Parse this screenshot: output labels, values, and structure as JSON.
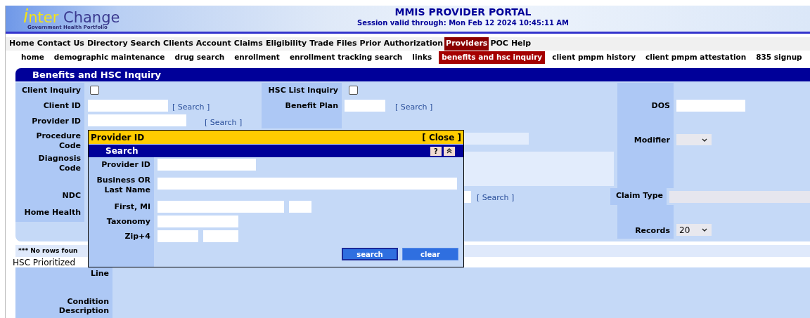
{
  "header": {
    "logo": {
      "mark": "i",
      "first": "nter",
      "second": "Change",
      "tagline": "Government Health Portfolio"
    },
    "title": "MMIS PROVIDER PORTAL",
    "session": "Session valid through: Mon Feb 12 2024 10:45:11 AM"
  },
  "main_menu": [
    {
      "label": "Home",
      "selected": false
    },
    {
      "label": "Contact Us",
      "selected": false
    },
    {
      "label": "Directory Search",
      "selected": false
    },
    {
      "label": "Clients",
      "selected": false
    },
    {
      "label": "Account",
      "selected": false
    },
    {
      "label": "Claims",
      "selected": false
    },
    {
      "label": "Eligibility",
      "selected": false
    },
    {
      "label": "Trade Files",
      "selected": false
    },
    {
      "label": "Prior Authorization",
      "selected": false
    },
    {
      "label": "Providers",
      "selected": true
    },
    {
      "label": "POC",
      "selected": false
    },
    {
      "label": "Help",
      "selected": false
    }
  ],
  "sub_menu": [
    {
      "label": "home",
      "selected": false
    },
    {
      "label": "demographic maintenance",
      "selected": false
    },
    {
      "label": "drug search",
      "selected": false
    },
    {
      "label": "enrollment",
      "selected": false
    },
    {
      "label": "enrollment tracking search",
      "selected": false
    },
    {
      "label": "links",
      "selected": false
    },
    {
      "label": "benefits and hsc inquiry",
      "selected": true
    },
    {
      "label": "client pmpm history",
      "selected": false
    },
    {
      "label": "client pmpm attestation",
      "selected": false
    },
    {
      "label": "835 signup",
      "selected": false
    }
  ],
  "panel": {
    "title": "Benefits and HSC Inquiry",
    "client_inquiry": {
      "label": "Client Inquiry",
      "checked": false
    },
    "hsc_list_inquiry": {
      "label": "HSC List Inquiry",
      "checked": false
    },
    "client_id": {
      "label": "Client ID",
      "link": "[ Search ]"
    },
    "benefit_plan": {
      "label": "Benefit Plan",
      "link": "[ Search ]"
    },
    "dos": {
      "label": "DOS"
    },
    "provider_id": {
      "label": "Provider ID",
      "link": "[ Search ]"
    },
    "procedure_code": {
      "label": "Procedure Code",
      "disabled": true
    },
    "modifier": {
      "label": "Modifier"
    },
    "diagnosis_code": {
      "label": "Diagnosis Code"
    },
    "ndc": {
      "label": "NDC",
      "link": "[ Search ]"
    },
    "claim_type": {
      "label": "Claim Type",
      "disabled": true
    },
    "home_health": {
      "label": "Home Health"
    },
    "records": {
      "label": "Records",
      "value": "20"
    }
  },
  "results": {
    "message": "*** No rows foun",
    "hsc_title": "HSC Prioritized",
    "labels": [
      "Line",
      "Condition Description"
    ]
  },
  "popup": {
    "title": "Provider ID",
    "close": "[ Close ]",
    "subtitle": "Search",
    "help": "?",
    "fields": [
      {
        "label": "Provider ID",
        "kind": "single"
      },
      {
        "label": "Business OR Last Name",
        "kind": "wide"
      },
      {
        "label": "First, MI",
        "kind": "name"
      },
      {
        "label": "Taxonomy",
        "kind": "single"
      },
      {
        "label": "Zip+4",
        "kind": "zip"
      }
    ],
    "buttons": [
      "search",
      "clear"
    ]
  }
}
